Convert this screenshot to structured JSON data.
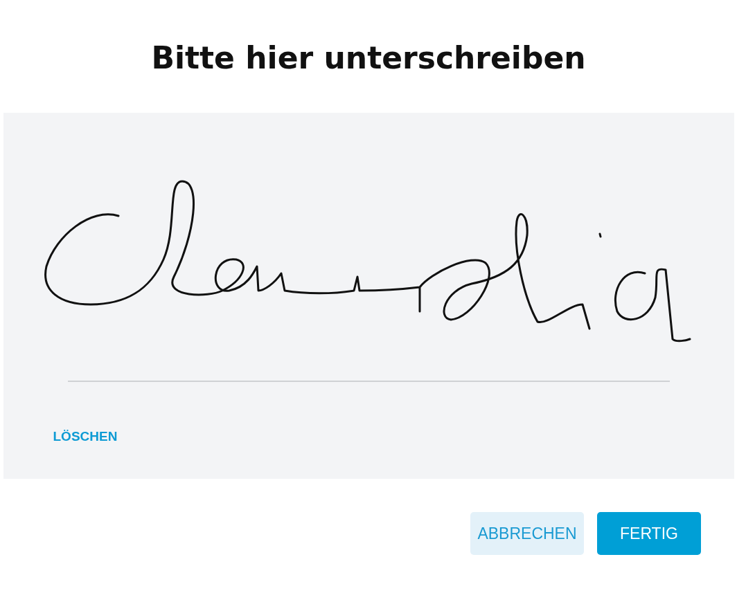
{
  "title": "Bitte hier unterschreiben",
  "signature_pad": {
    "signed": true,
    "clear_label": "LÖSCHEN"
  },
  "buttons": [
    {
      "label": "ABBRECHEN",
      "kind": "secondary"
    },
    {
      "label": "FERTIG",
      "kind": "primary"
    }
  ]
}
